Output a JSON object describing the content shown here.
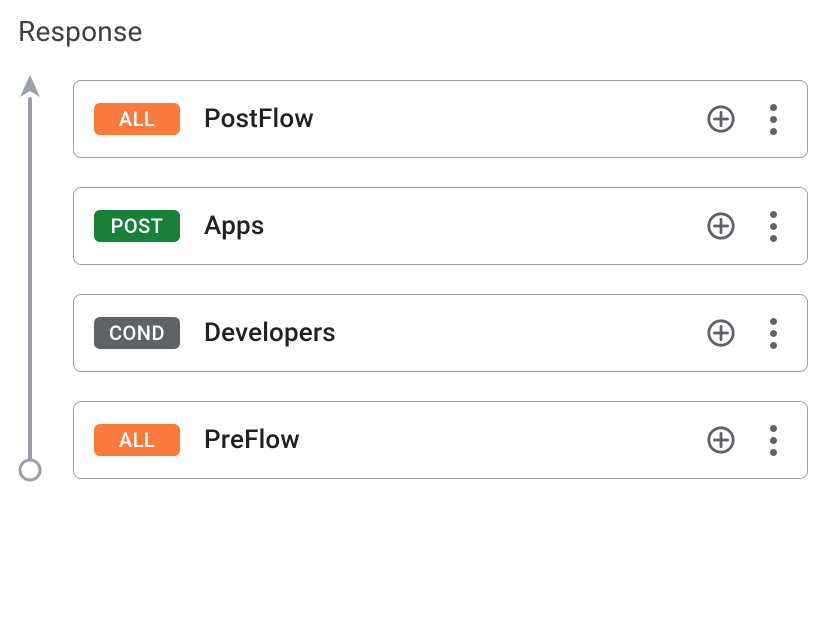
{
  "section_title": "Response",
  "badge_colors": {
    "ALL": "#fa7b3d",
    "POST": "#188038",
    "COND": "#5f6368"
  },
  "flows": [
    {
      "badge": "ALL",
      "label": "PostFlow"
    },
    {
      "badge": "POST",
      "label": "Apps"
    },
    {
      "badge": "COND",
      "label": "Developers"
    },
    {
      "badge": "ALL",
      "label": "PreFlow"
    }
  ],
  "icons": {
    "add": "plus-circle-icon",
    "more": "more-vert-icon"
  }
}
